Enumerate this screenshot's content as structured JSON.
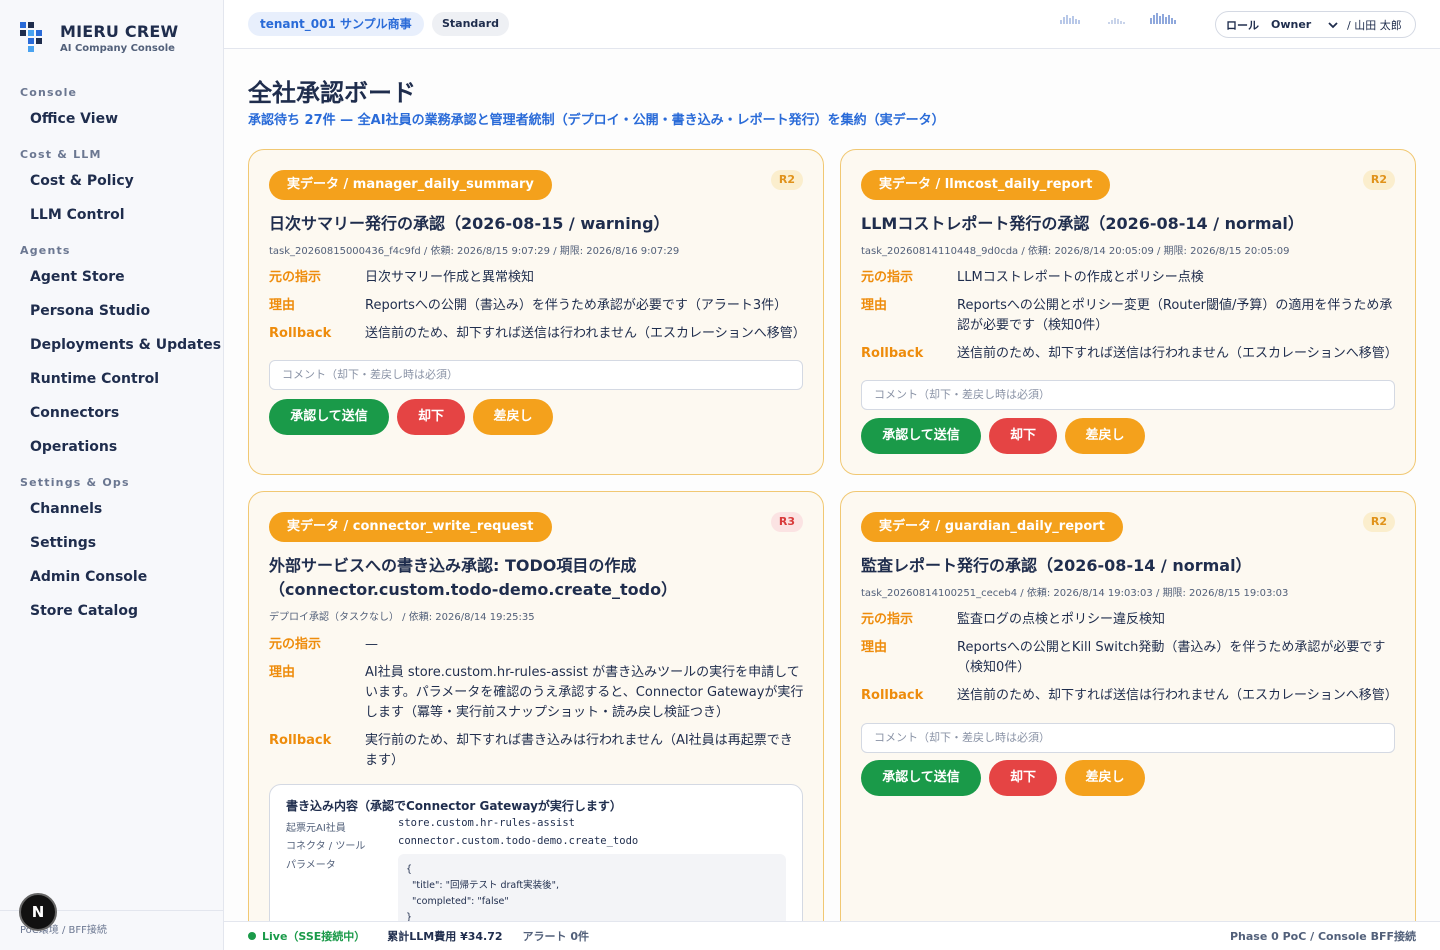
{
  "brand": {
    "title": "MIERU CREW",
    "subtitle": "AI Company Console",
    "accent": "#2a6bd8"
  },
  "sidebar": {
    "sections": [
      {
        "label": "Console",
        "items": [
          "Office View"
        ]
      },
      {
        "label": "Cost & LLM",
        "items": [
          "Cost & Policy",
          "LLM Control"
        ]
      },
      {
        "label": "Agents",
        "items": [
          "Agent Store",
          "Persona Studio",
          "Deployments & Updates",
          "Runtime Control",
          "Connectors",
          "Operations"
        ]
      },
      {
        "label": "Settings & Ops",
        "items": [
          "Channels",
          "Settings",
          "Admin Console",
          "Store Catalog"
        ]
      }
    ],
    "footer": "PoC環境 / BFF接続",
    "badge_letter": "N"
  },
  "header": {
    "tenant": "tenant_001 サンプル商事",
    "plan": "Standard",
    "role_label": "ロール",
    "role_value": "Owner",
    "user": "/ 山田 太郎"
  },
  "page": {
    "title": "全社承認ボード",
    "subtitle": "承認待ち 27件 — 全AI社員の業務承認と管理者統制（デプロイ・公開・書き込み・レポート発行）を集約（実データ）"
  },
  "labels": {
    "instruction": "元の指示",
    "reason": "理由",
    "rollback": "Rollback",
    "comment_placeholder": "コメント（却下・差戻し時は必須）",
    "approve": "承認して送信",
    "reject": "却下",
    "return": "差戻し"
  },
  "cards": [
    {
      "tag": "実データ / manager_daily_summary",
      "risk": "R2",
      "title": "日次サマリー発行の承認（2026-08-15 / warning）",
      "meta": "task_20260815000436_f4c9fd / 依頼: 2026/8/15 9:07:29 / 期限: 2026/8/16 9:07:29",
      "instruction": "日次サマリー作成と異常検知",
      "reason": "Reportsへの公開（書込み）を伴うため承認が必要です（アラート3件）",
      "rollback": "送信前のため、却下すれば送信は行われません（エスカレーションへ移管）"
    },
    {
      "tag": "実データ / llmcost_daily_report",
      "risk": "R2",
      "title": "LLMコストレポート発行の承認（2026-08-14 / normal）",
      "meta": "task_20260814110448_9d0cda / 依頼: 2026/8/14 20:05:09 / 期限: 2026/8/15 20:05:09",
      "instruction": "LLMコストレポートの作成とポリシー点検",
      "reason": "Reportsへの公開とポリシー変更（Router閾値/予算）の適用を伴うため承認が必要です（検知0件）",
      "rollback": "送信前のため、却下すれば送信は行われません（エスカレーションへ移管）"
    },
    {
      "tag": "実データ / connector_write_request",
      "risk": "R3",
      "title": "外部サービスへの書き込み承認: TODO項目の作成（connector.custom.todo-demo.create_todo）",
      "meta": "デプロイ承認（タスクなし） / 依頼: 2026/8/14 19:25:35",
      "instruction": "—",
      "reason": "AI社員 store.custom.hr-rules-assist が書き込みツールの実行を申請しています。パラメータを確認のうえ承認すると、Connector Gatewayが実行します（冪等・実行前スナップショット・読み戻し検証つき）",
      "rollback": "実行前のため、却下すれば書き込みは行われません（AI社員は再起票できます）",
      "write": {
        "title": "書き込み内容（承認でConnector Gatewayが実行します）",
        "agent_label": "起票元AI社員",
        "agent_value": "store.custom.hr-rules-assist",
        "tool_label": "コネクタ / ツール",
        "tool_value": "connector.custom.todo-demo.create_todo",
        "params_label": "パラメータ",
        "params_value": "{\n  \"title\": \"回帰テスト draft実装後\",\n  \"completed\": \"false\"\n}"
      }
    },
    {
      "tag": "実データ / guardian_daily_report",
      "risk": "R2",
      "title": "監査レポート発行の承認（2026-08-14 / normal）",
      "meta": "task_20260814100251_ceceb4 / 依頼: 2026/8/14 19:03:03 / 期限: 2026/8/15 19:03:03",
      "instruction": "監査ログの点検とポリシー違反検知",
      "reason": "Reportsへの公開とKill Switch発動（書込み）を伴うため承認が必要です（検知0件）",
      "rollback": "送信前のため、却下すれば送信は行われません（エスカレーションへ移管）"
    }
  ],
  "footer": {
    "live": "Live（SSE接続中）",
    "cost": "累計LLM費用 ¥34.72",
    "alert": "アラート 0件",
    "phase": "Phase 0 PoC / Console BFF接続"
  }
}
